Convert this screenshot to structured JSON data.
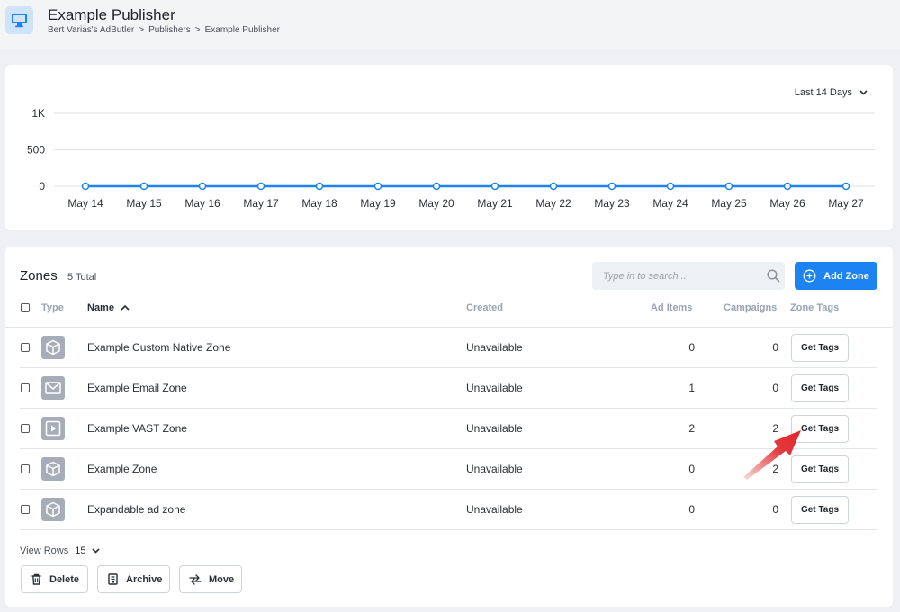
{
  "header": {
    "title": "Example Publisher",
    "breadcrumb": [
      "Bert Varias's AdButler",
      ">",
      "Publishers",
      ">",
      "Example Publisher"
    ]
  },
  "chart_data": {
    "type": "line",
    "range_label": "Last 14 Days",
    "categories": [
      "May 14",
      "May 15",
      "May 16",
      "May 17",
      "May 18",
      "May 19",
      "May 20",
      "May 21",
      "May 22",
      "May 23",
      "May 24",
      "May 25",
      "May 26",
      "May 27"
    ],
    "series": [
      {
        "values": [
          0,
          0,
          0,
          0,
          0,
          0,
          0,
          0,
          0,
          0,
          0,
          0,
          0,
          0
        ]
      }
    ],
    "ytick_labels": [
      "1K",
      "500",
      "0"
    ],
    "ylim": [
      0,
      1000
    ],
    "grid": true,
    "color": "#1d83f2"
  },
  "zones": {
    "title": "Zones",
    "total": "5 Total",
    "search_placeholder": "Type in to search...",
    "add_label": "Add Zone",
    "columns": {
      "type": "Type",
      "name": "Name",
      "created": "Created",
      "ad_items": "Ad Items",
      "campaigns": "Campaigns",
      "zone_tags": "Zone Tags"
    },
    "rows": [
      {
        "icon": "cube-icon",
        "name": "Example Custom Native Zone",
        "created": "Unavailable",
        "ad_items": "0",
        "campaigns": "0",
        "action": "Get Tags"
      },
      {
        "icon": "envelope-icon",
        "name": "Example Email Zone",
        "created": "Unavailable",
        "ad_items": "1",
        "campaigns": "0",
        "action": "Get Tags"
      },
      {
        "icon": "play-icon",
        "name": "Example VAST Zone",
        "created": "Unavailable",
        "ad_items": "2",
        "campaigns": "2",
        "action": "Get Tags"
      },
      {
        "icon": "cube-icon",
        "name": "Example Zone",
        "created": "Unavailable",
        "ad_items": "0",
        "campaigns": "2",
        "action": "Get Tags"
      },
      {
        "icon": "cube-icon",
        "name": "Expandable ad zone",
        "created": "Unavailable",
        "ad_items": "0",
        "campaigns": "0",
        "action": "Get Tags"
      }
    ],
    "view_rows_label": "View Rows",
    "view_rows_value": "15",
    "actions": {
      "delete": "Delete",
      "archive": "Archive",
      "move": "Move"
    }
  },
  "colors": {
    "accent": "#1d83f2",
    "annotation_arrow": "#e0252b"
  }
}
